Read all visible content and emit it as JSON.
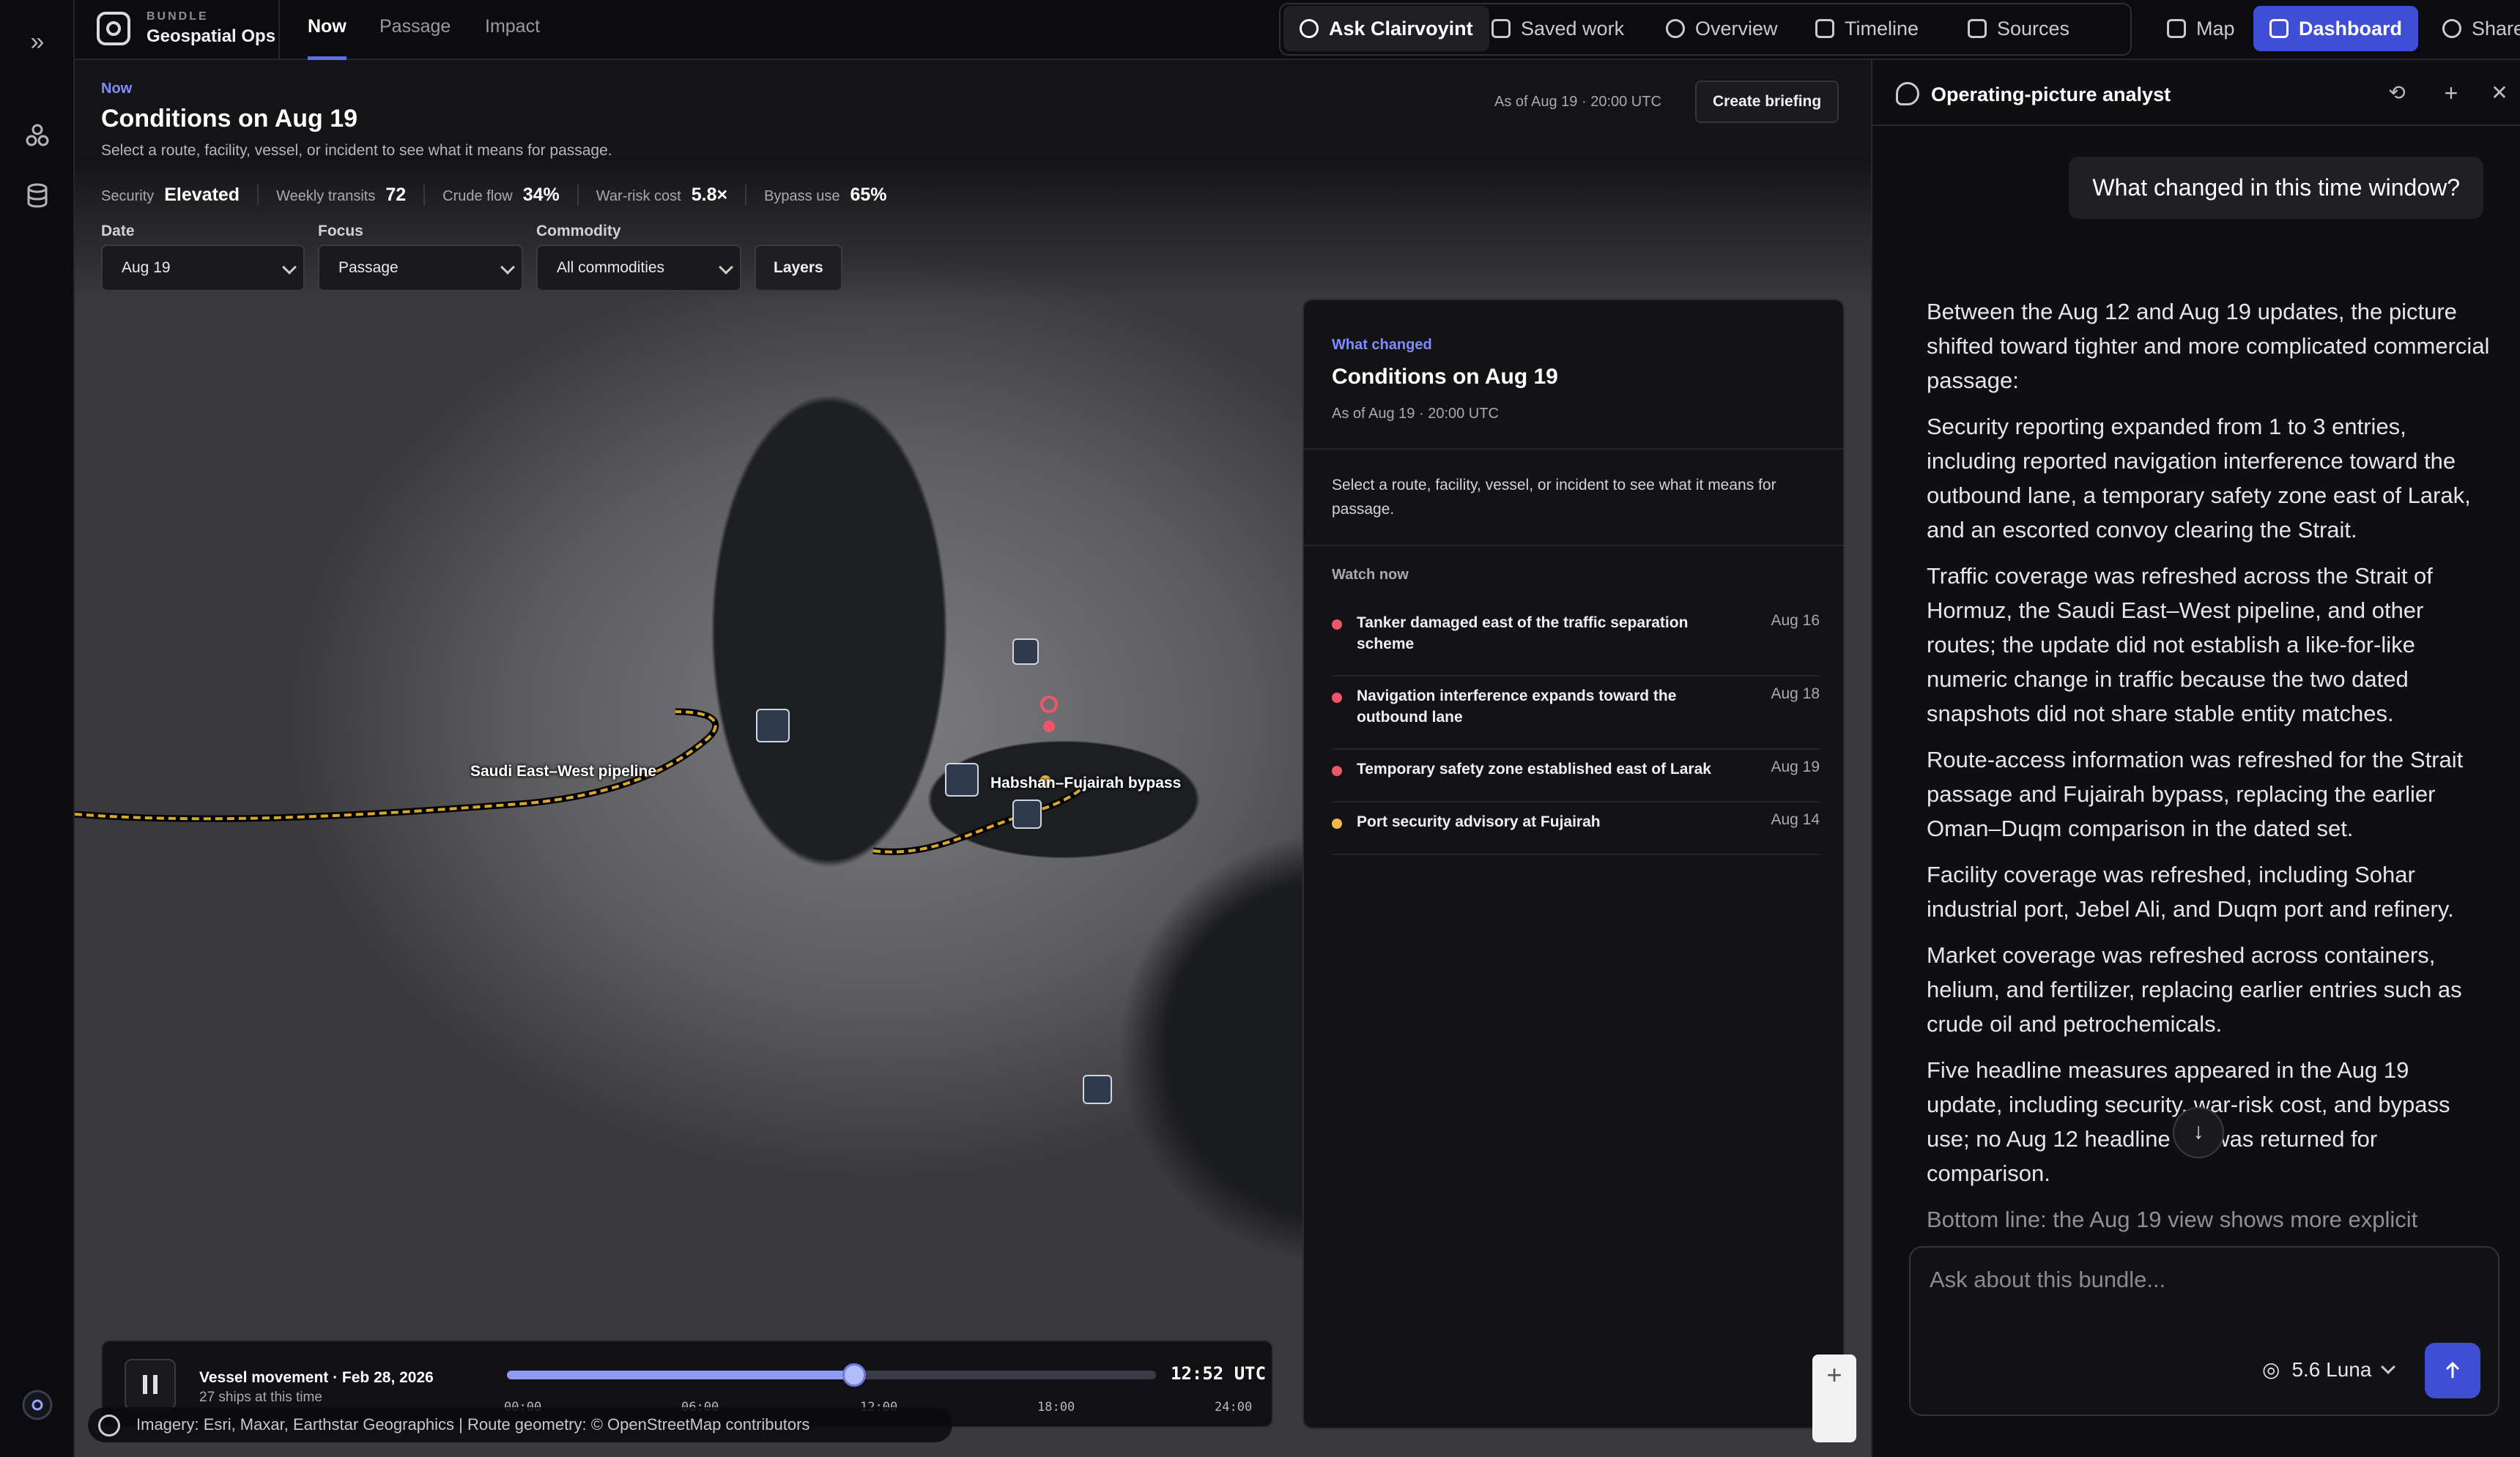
{
  "app": {
    "bundle_label": "BUNDLE",
    "name": "Geospatial Ops"
  },
  "tabs": [
    {
      "label": "Now",
      "active": true
    },
    {
      "label": "Passage",
      "active": false
    },
    {
      "label": "Impact",
      "active": false
    }
  ],
  "toolbar": {
    "ask": "Ask Clairvoyint",
    "saved": "Saved work",
    "overview": "Overview",
    "timeline": "Timeline",
    "sources": "Sources",
    "map": "Map",
    "dashboard": "Dashboard",
    "share": "Share",
    "more": "···"
  },
  "header": {
    "eyebrow": "Now",
    "title": "Conditions on Aug 19",
    "subtitle": "Select a route, facility, vessel, or incident to see what it means for passage.",
    "as_of": "As of Aug 19 · 20:00 UTC",
    "briefing_button": "Create briefing"
  },
  "metrics": [
    {
      "label": "Security",
      "value": "Elevated"
    },
    {
      "label": "Weekly transits",
      "value": "72"
    },
    {
      "label": "Crude flow",
      "value": "34%"
    },
    {
      "label": "War-risk cost",
      "value": "5.8×"
    },
    {
      "label": "Bypass use",
      "value": "65%"
    }
  ],
  "controls": {
    "date_label": "Date",
    "date_value": "Aug 19",
    "focus_label": "Focus",
    "focus_value": "Passage",
    "commodity_label": "Commodity",
    "commodity_value": "All commodities",
    "layers_button": "Layers"
  },
  "map_labels": {
    "pipeline": "Saudi East–West pipeline",
    "bypass": "Habshan–Fujairah bypass"
  },
  "what_changed": {
    "eyebrow": "What changed",
    "title": "Conditions on Aug 19",
    "as_of": "As of Aug 19 · 20:00 UTC",
    "description": "Select a route, facility, vessel, or incident to see what it means for passage.",
    "watch_label": "Watch now",
    "items": [
      {
        "title": "Tanker damaged east of the traffic separation scheme",
        "date": "Aug 16",
        "color": "#f0566a"
      },
      {
        "title": "Navigation interference expands toward the outbound lane",
        "date": "Aug 18",
        "color": "#f0566a"
      },
      {
        "title": "Temporary safety zone established east of Larak",
        "date": "Aug 19",
        "color": "#f0566a"
      },
      {
        "title": "Port security advisory at Fujairah",
        "date": "Aug 14",
        "color": "#f2b84b"
      }
    ]
  },
  "player": {
    "title": "Vessel movement · Feb 28, 2026",
    "subtitle": "27 ships at this time",
    "progress": 0.535,
    "ticks": [
      "00:00",
      "06:00",
      "12:00",
      "18:00",
      "24:00"
    ],
    "clock": "12:52 UTC"
  },
  "attribution": "Imagery: Esri, Maxar, Earthstar Geographics | Route geometry: © OpenStreetMap contributors",
  "panel": {
    "title": "Operating-picture analyst",
    "user_message": "What changed in this time window?",
    "answer": [
      "Between the Aug 12 and Aug 19 updates, the picture shifted toward tighter and more complicated commercial passage:",
      "Security reporting expanded from 1 to 3 entries, including reported navigation interference toward the outbound lane, a temporary safety zone east of Larak, and an escorted convoy clearing the Strait.",
      "Traffic coverage was refreshed across the Strait of Hormuz, the Saudi East–West pipeline, and other routes; the update did not establish a like-for-like numeric change in traffic because the two dated snapshots did not share stable entity matches.",
      "Route-access information was refreshed for the Strait passage and Fujairah bypass, replacing the earlier Oman–Duqm comparison in the dated set.",
      "Facility coverage was refreshed, including Sohar industrial port, Jebel Ali, and Duqm port and refinery.",
      "Market coverage was refreshed across containers, helium, and fertilizer, replacing earlier entries such as crude oil and petrochemicals.",
      "Five headline measures appeared in the Aug 19 update, including security, war-risk cost, and bypass use; no Aug 12 headline set was returned for comparison."
    ],
    "answer_tail": "Bottom line: the Aug 19 view shows more explicit",
    "composer_placeholder": "Ask about this bundle...",
    "model": "5.6 Luna"
  },
  "colors": {
    "accent": "#3e4fd6",
    "route": "#d9a72b"
  }
}
